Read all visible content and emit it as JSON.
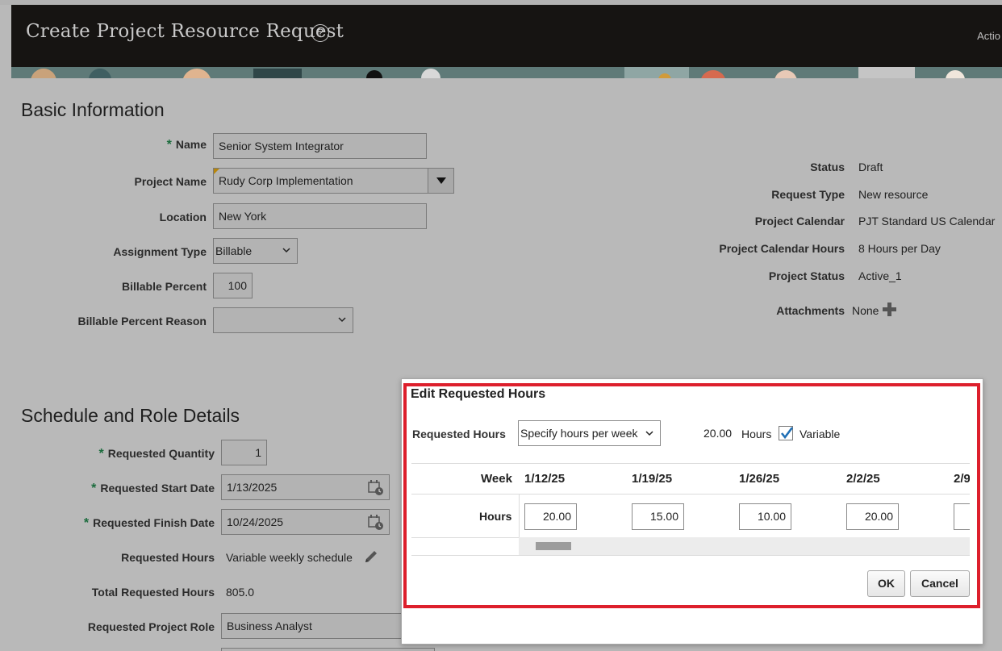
{
  "header": {
    "title": "Create Project Resource Request",
    "help_glyph": "?",
    "actions": "Actio"
  },
  "basic": {
    "heading": "Basic Information",
    "name_label": "Name",
    "name_value": "Senior System Integrator",
    "project_label": "Project Name",
    "project_value": "Rudy Corp Implementation",
    "location_label": "Location",
    "location_value": "New York",
    "assignment_label": "Assignment Type",
    "assignment_value": "Billable",
    "billable_pct_label": "Billable Percent",
    "billable_pct_value": "100",
    "billable_reason_label": "Billable Percent Reason",
    "billable_reason_value": ""
  },
  "status_panel": {
    "status_label": "Status",
    "status_value": "Draft",
    "request_type_label": "Request Type",
    "request_type_value": "New resource",
    "calendar_label": "Project Calendar",
    "calendar_value": "PJT Standard US Calendar",
    "calendar_hours_label": "Project Calendar Hours",
    "calendar_hours_value": "8 Hours per Day",
    "project_status_label": "Project Status",
    "project_status_value": "Active_1",
    "attachments_label": "Attachments",
    "attachments_value": "None"
  },
  "schedule": {
    "heading": "Schedule and Role Details",
    "quantity_label": "Requested Quantity",
    "quantity_value": "1",
    "start_label": "Requested Start Date",
    "start_value": "1/13/2025",
    "finish_label": "Requested Finish Date",
    "finish_value": "10/24/2025",
    "hours_label": "Requested Hours",
    "hours_value": "Variable weekly schedule",
    "total_label": "Total Requested Hours",
    "total_value": "805.0",
    "role_label": "Requested Project Role",
    "role_value": "Business Analyst"
  },
  "dialog": {
    "title": "Edit Requested Hours",
    "requested_hours_label": "Requested Hours",
    "requested_hours_option": "Specify hours per week",
    "hours_number": "20.00",
    "hours_unit": "Hours",
    "variable_checked": true,
    "variable_label": "Variable",
    "week_header": "Week",
    "hours_row_label": "Hours",
    "weeks": [
      "1/12/25",
      "1/19/25",
      "1/26/25",
      "2/2/25",
      "2/9"
    ],
    "hours": [
      "20.00",
      "15.00",
      "10.00",
      "20.00",
      ""
    ],
    "ok_label": "OK",
    "cancel_label": "Cancel"
  },
  "colors": {
    "header_bg": "#161412",
    "overlay_bg": "#b9b9b9",
    "highlight_border": "#dd1f2c",
    "required_mark": "#1a6b3c",
    "checkbox_check": "#1f6fb5"
  }
}
